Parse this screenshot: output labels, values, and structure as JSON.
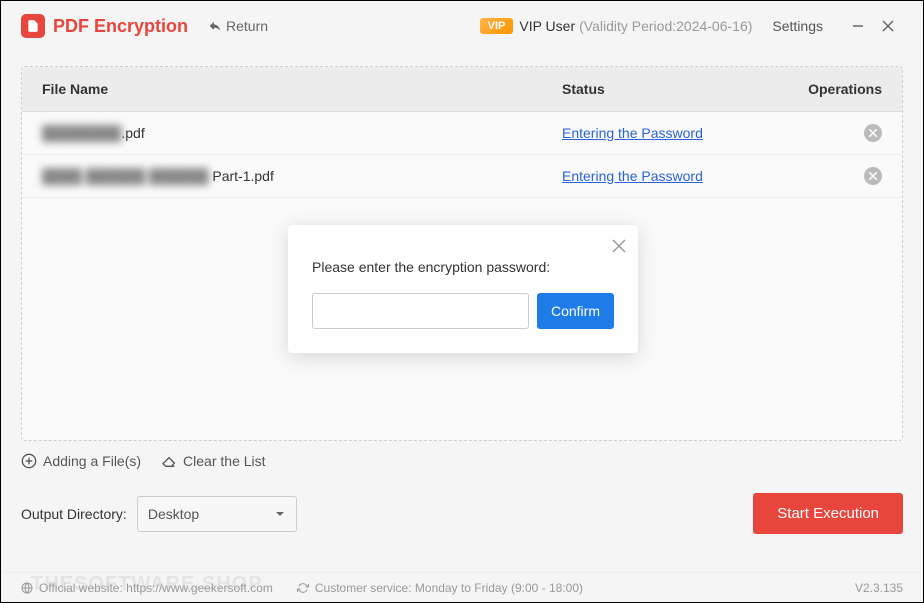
{
  "app": {
    "title": "PDF Encryption",
    "return_label": "Return",
    "vip_badge": "VIP",
    "vip_user": "VIP User",
    "validity": "(Validity Period:2024-06-16)",
    "settings": "Settings"
  },
  "table": {
    "headers": {
      "file": "File Name",
      "status": "Status",
      "ops": "Operations"
    },
    "rows": [
      {
        "name_blur": "████████",
        "name_suffix": ".pdf",
        "status": "Entering the Password"
      },
      {
        "name_blur": "████ ██████ ██████",
        "name_suffix": " Part-1.pdf",
        "status": "Entering the Password"
      }
    ]
  },
  "actions": {
    "add_file": "Adding a File(s)",
    "clear_list": "Clear the List"
  },
  "output": {
    "label": "Output Directory:",
    "selected": "Desktop"
  },
  "exec_button": "Start Execution",
  "footer": {
    "website": "Official website: https://www.geekersoft.com",
    "service": "Customer service: Monday to Friday (9:00 - 18:00)",
    "version": "V2.3.135"
  },
  "modal": {
    "prompt": "Please enter the encryption password:",
    "confirm": "Confirm"
  },
  "watermark": "THESOFTWARE.SHOP"
}
